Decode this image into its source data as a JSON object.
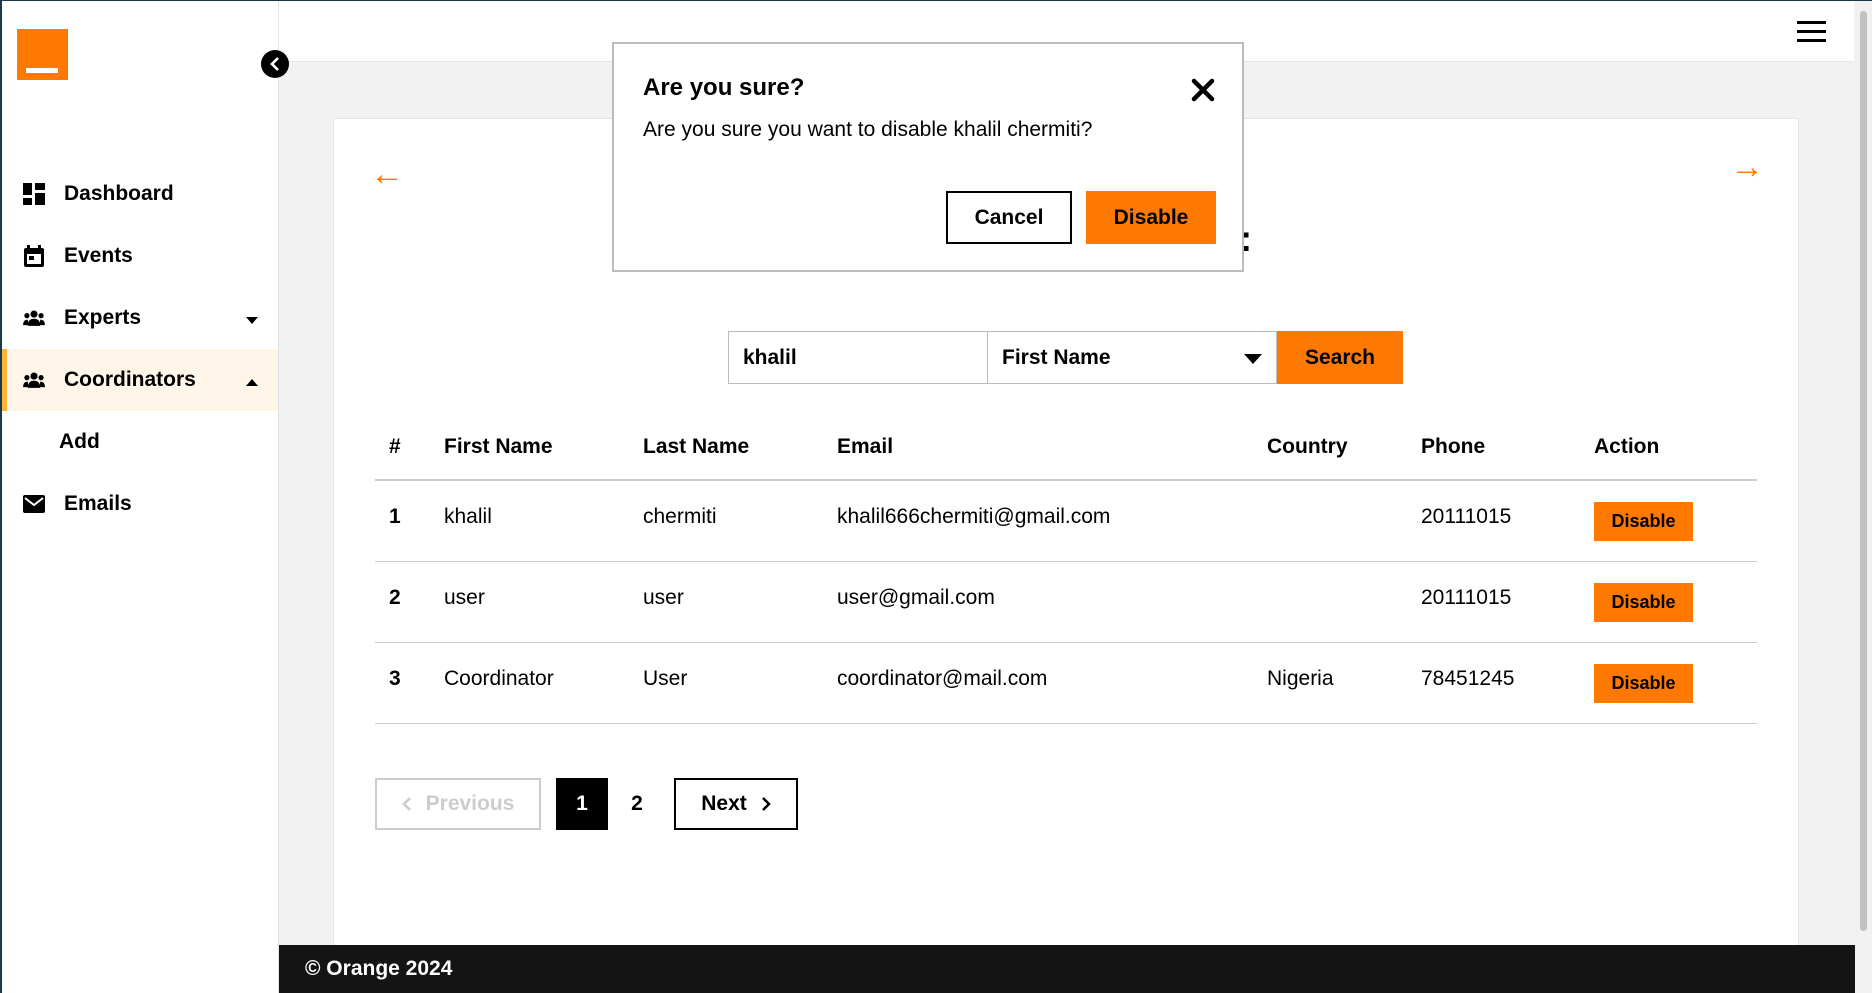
{
  "sidebar": {
    "items": [
      {
        "label": "Dashboard",
        "icon": "dashboard-icon"
      },
      {
        "label": "Events",
        "icon": "calendar-icon"
      },
      {
        "label": "Experts",
        "icon": "users-icon"
      },
      {
        "label": "Coordinators",
        "icon": "users-icon"
      },
      {
        "label": "Add"
      },
      {
        "label": "Emails",
        "icon": "envelope-icon"
      }
    ]
  },
  "search": {
    "value": "khalil",
    "filter_selected": "First Name",
    "button_label": "Search"
  },
  "table": {
    "headers": [
      "#",
      "First Name",
      "Last Name",
      "Email",
      "Country",
      "Phone",
      "Action"
    ],
    "rows": [
      {
        "num": "1",
        "first": "khalil",
        "last": "chermiti",
        "email": "khalil666chermiti@gmail.com",
        "country": "",
        "phone": "20111015",
        "action": "Disable"
      },
      {
        "num": "2",
        "first": "user",
        "last": "user",
        "email": "user@gmail.com",
        "country": "",
        "phone": "20111015",
        "action": "Disable"
      },
      {
        "num": "3",
        "first": "Coordinator",
        "last": "User",
        "email": "coordinator@mail.com",
        "country": "Nigeria",
        "phone": "78451245",
        "action": "Disable"
      }
    ]
  },
  "pagination": {
    "previous_label": "Previous",
    "pages": [
      "1",
      "2"
    ],
    "current": "1",
    "next_label": "Next"
  },
  "footer": {
    "text": "© Orange 2024"
  },
  "modal": {
    "title": "Are you sure?",
    "message": "Are you sure you want to disable khalil chermiti?",
    "cancel_label": "Cancel",
    "confirm_label": "Disable"
  },
  "colors": {
    "accent": "#ff7900",
    "active_border": "#ffb53b",
    "footer_bg": "#141414"
  }
}
